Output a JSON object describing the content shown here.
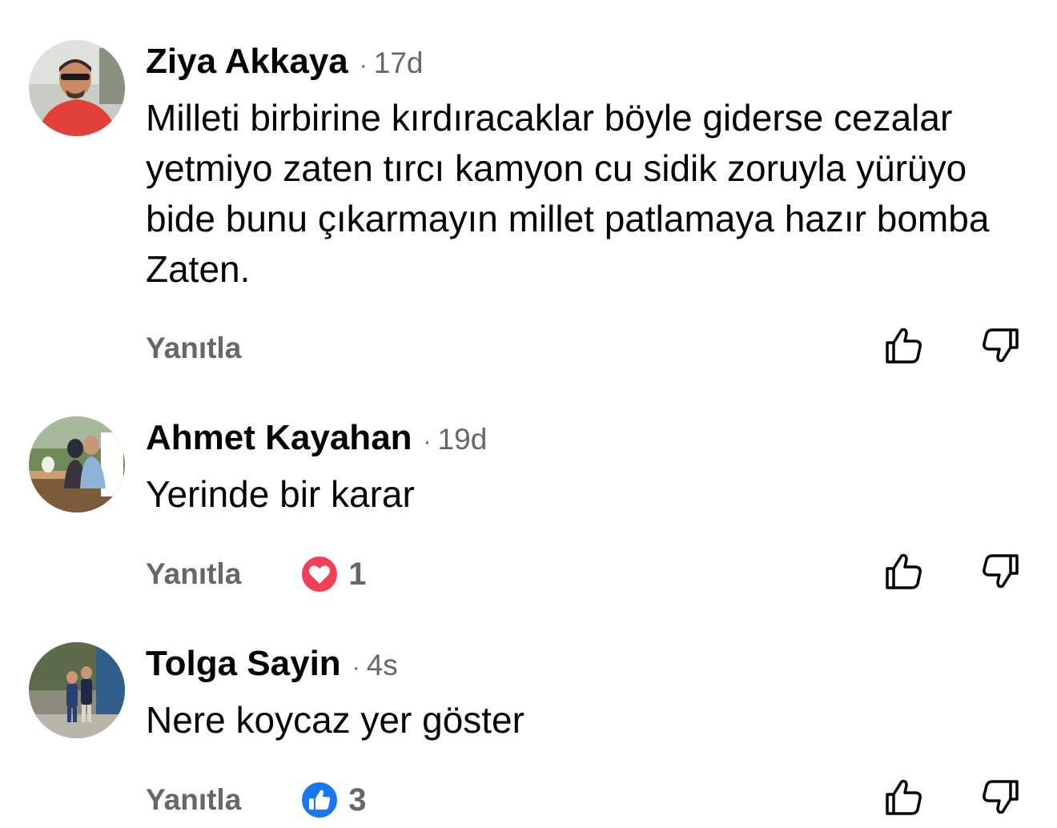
{
  "comments": [
    {
      "author": "Ziya Akkaya",
      "time": "17d",
      "text": "Milleti birbirine kırdıracaklar böyle giderse cezalar yetmiyo zaten tırcı kamyon cu sidik zoruyla yürüyo bide bunu çıkarmayın millet patlamaya hazır bomba Zaten.",
      "reply_label": "Yanıtla",
      "reaction": null
    },
    {
      "author": "Ahmet Kayahan",
      "time": "19d",
      "text": "Yerinde bir karar",
      "reply_label": "Yanıtla",
      "reaction": {
        "icon": "heart-reaction-icon",
        "count": "1",
        "color": "#f33e58"
      }
    },
    {
      "author": "Tolga Sayin",
      "time": "4s",
      "text": "Nere koycaz yer göster",
      "reply_label": "Yanıtla",
      "reaction": {
        "icon": "like-reaction-icon",
        "count": "3",
        "color": "#1877f2"
      }
    }
  ],
  "separator": "·",
  "icons": {
    "upvote": "thumbs-up-outline-icon",
    "downvote": "thumbs-down-outline-icon"
  },
  "colors": {
    "text": "#050505",
    "secondary": "#65676b",
    "heart": "#f33e58",
    "like": "#1877f2"
  }
}
